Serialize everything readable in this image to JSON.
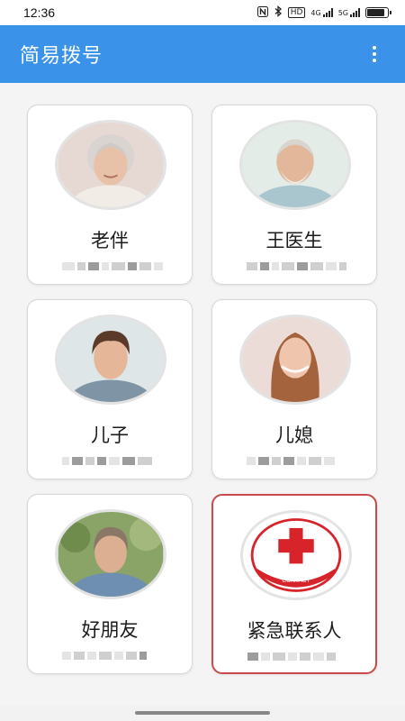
{
  "status_bar": {
    "time": "12:36",
    "icons": [
      "nfc-icon",
      "bluetooth-icon",
      "hd-icon",
      "signal-4g-icon",
      "signal-5g-icon",
      "battery-icon"
    ],
    "hd_label": "HD",
    "net1_label": "4G",
    "net2_label": "5G",
    "battery_level": 0.85
  },
  "app_bar": {
    "title": "简易拨号",
    "menu_icon": "overflow-menu-icon"
  },
  "contacts": [
    {
      "name": "老伴",
      "avatar": "elderly-woman-portrait"
    },
    {
      "name": "王医生",
      "avatar": "elderly-man-portrait"
    },
    {
      "name": "儿子",
      "avatar": "young-man-portrait"
    },
    {
      "name": "儿媳",
      "avatar": "young-woman-portrait"
    },
    {
      "name": "好朋友",
      "avatar": "middle-aged-woman-portrait"
    },
    {
      "name": "紧急联系人",
      "avatar": "emergency-contact-red-cross-logo",
      "logo_text": "EMERGENCY CONTACT",
      "highlight_color": "#c94a4a"
    }
  ],
  "colors": {
    "app_bar": "#3a93e8",
    "background": "#f4f4f4",
    "card": "#ffffff",
    "emergency_border": "#c94a4a",
    "red_cross": "#d6242a"
  }
}
